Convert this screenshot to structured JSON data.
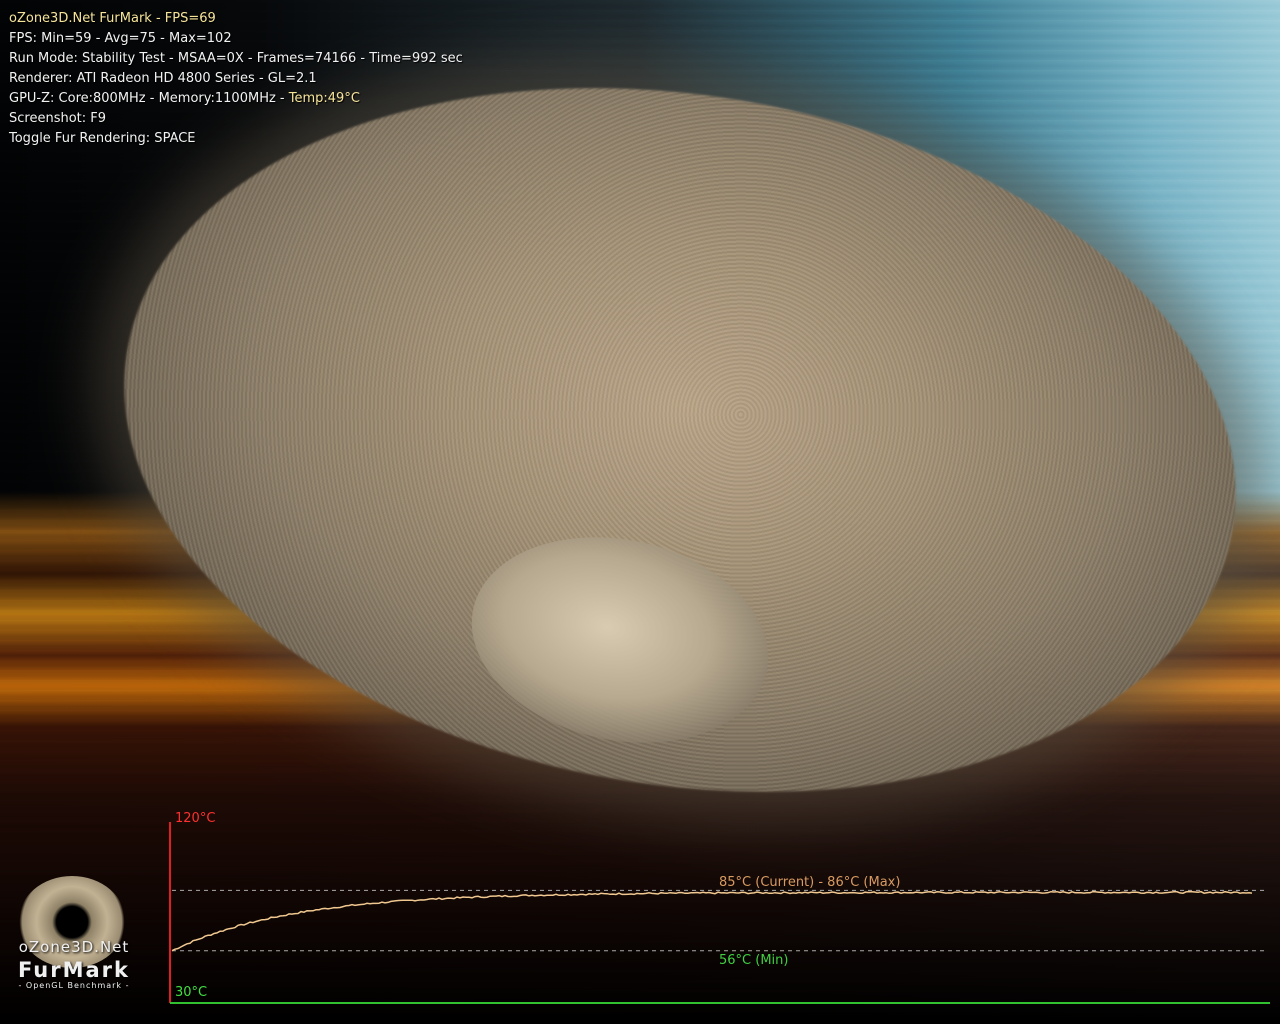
{
  "hud": {
    "app_prefix": "oZone3D.Net FurMark - ",
    "fps_now": "FPS=69",
    "fps_stats": "FPS: Min=59 - Avg=75 - Max=102",
    "run_mode": "Run Mode: Stability Test - MSAA=0X - Frames=74166 - Time=992 sec",
    "renderer": "Renderer: ATI Radeon HD 4800 Series - GL=2.1",
    "gpuz_prefix": "GPU-Z: Core:800MHz - Memory:1100MHz - ",
    "gpuz_temp": "Temp:49°C",
    "screenshot": "Screenshot: F9",
    "toggle": "Toggle Fur Rendering: SPACE"
  },
  "logo": {
    "site": "oZone3D.Net",
    "name": "FurMark",
    "subtitle": "- OpenGL Benchmark -"
  },
  "graph": {
    "max_label": "120°C",
    "min_label": "30°C",
    "current_label": "85°C (Current) - 86°C (Max)",
    "low_label": "56°C (Min)",
    "y_range": [
      30,
      120
    ],
    "max_line_temp": 86,
    "min_line_temp": 56,
    "current_temp": 85,
    "colors": {
      "axis_y": "#e02020",
      "axis_x": "#30c030",
      "curve": "#f0c890",
      "max_label": "#ff3030",
      "min_label": "#40e040",
      "current_label": "#d89a60",
      "low_label": "#40d040",
      "dashed": "#aaaaaa"
    }
  }
}
